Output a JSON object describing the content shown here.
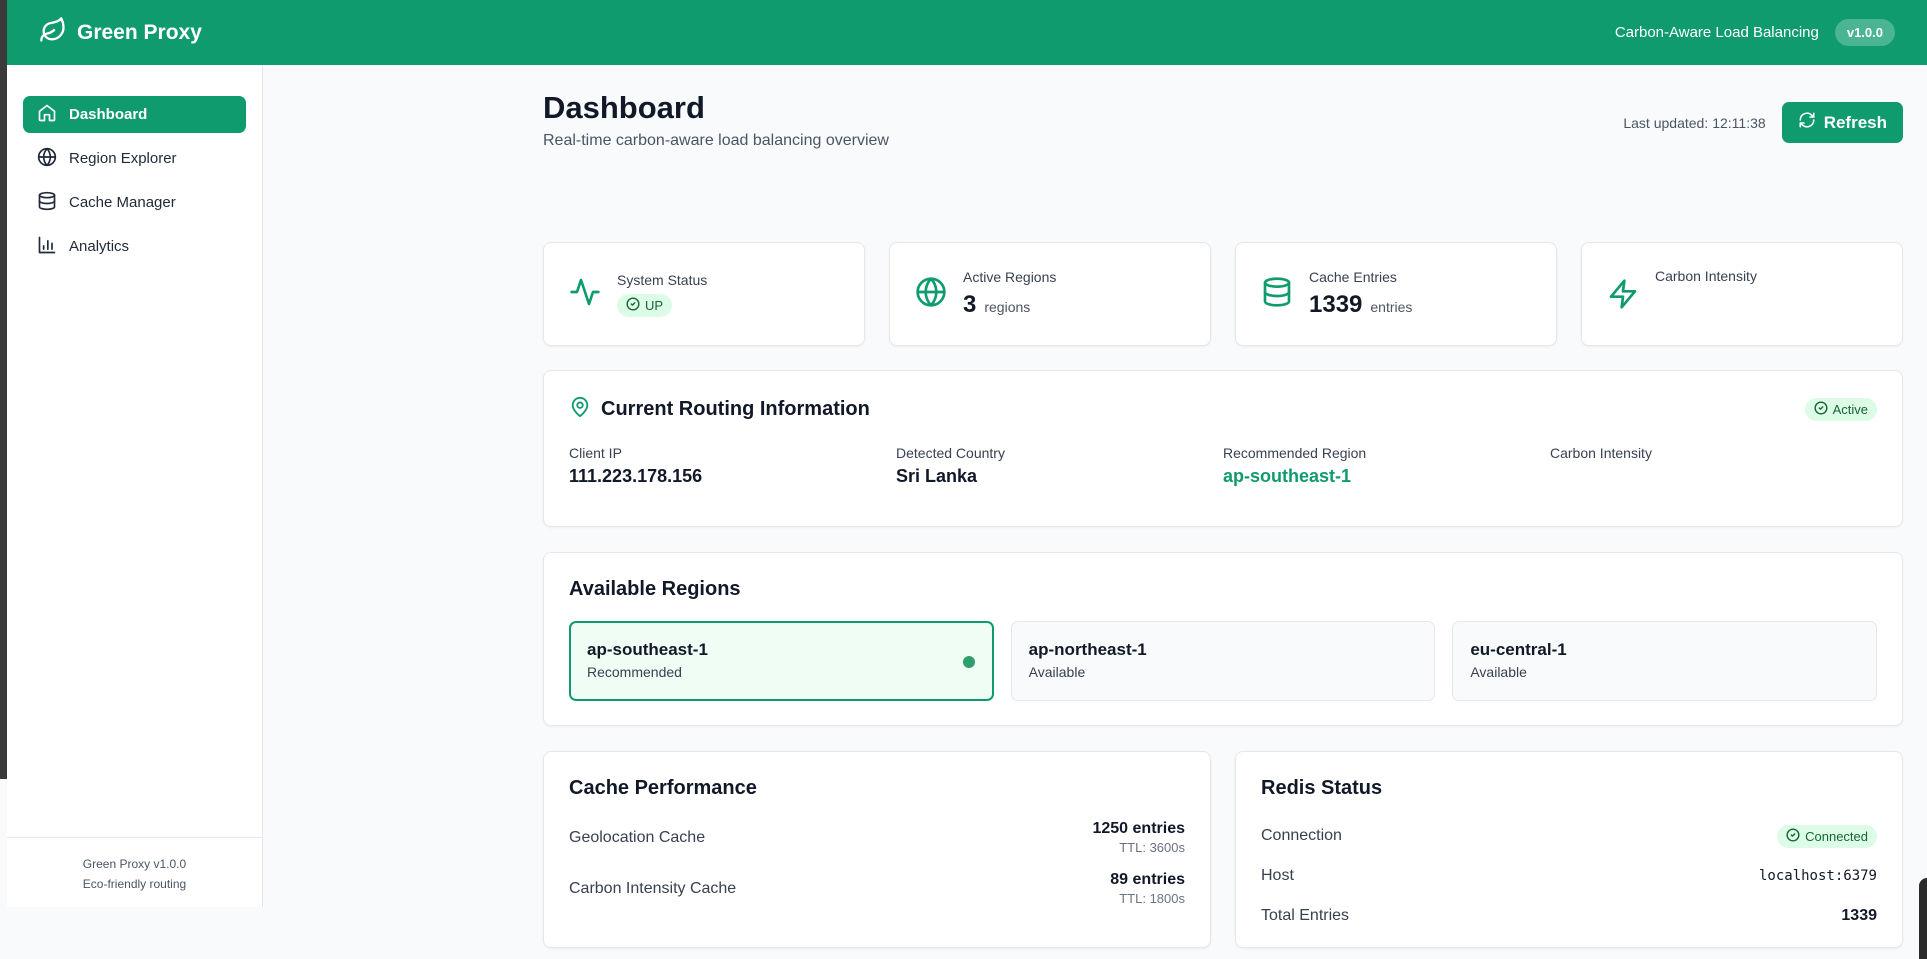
{
  "topbar": {
    "brand": "Green Proxy",
    "tagline": "Carbon-Aware Load Balancing",
    "version": "v1.0.0",
    "accent": "#0f9b6e"
  },
  "sidebar": {
    "items": [
      {
        "label": "Dashboard",
        "icon": "home-icon",
        "active": true
      },
      {
        "label": "Region Explorer",
        "icon": "globe-icon",
        "active": false
      },
      {
        "label": "Cache Manager",
        "icon": "database-icon",
        "active": false
      },
      {
        "label": "Analytics",
        "icon": "bar-chart-icon",
        "active": false
      }
    ],
    "footer_line1": "Green Proxy v1.0.0",
    "footer_line2": "Eco-friendly routing"
  },
  "header": {
    "title": "Dashboard",
    "subtitle": "Real-time carbon-aware load balancing overview",
    "last_updated_label": "Last updated:",
    "last_updated_time": "12:11:38",
    "refresh_label": "Refresh"
  },
  "stats": {
    "system_status": {
      "label": "System Status",
      "value": "UP"
    },
    "active_regions": {
      "label": "Active Regions",
      "value": "3",
      "unit": "regions"
    },
    "cache_entries": {
      "label": "Cache Entries",
      "value": "1339",
      "unit": "entries"
    },
    "carbon_intensity": {
      "label": "Carbon Intensity"
    }
  },
  "routing": {
    "title": "Current Routing Information",
    "status": "Active",
    "client_ip_label": "Client IP",
    "client_ip": "111.223.178.156",
    "country_label": "Detected Country",
    "country": "Sri Lanka",
    "region_label": "Recommended Region",
    "region": "ap-southeast-1",
    "carbon_label": "Carbon Intensity"
  },
  "regions": {
    "title": "Available Regions",
    "items": [
      {
        "name": "ap-southeast-1",
        "status": "Recommended"
      },
      {
        "name": "ap-northeast-1",
        "status": "Available"
      },
      {
        "name": "eu-central-1",
        "status": "Available"
      }
    ]
  },
  "cache_performance": {
    "title": "Cache Performance",
    "rows": [
      {
        "label": "Geolocation Cache",
        "count": "1250 entries",
        "ttl": "TTL: 3600s"
      },
      {
        "label": "Carbon Intensity Cache",
        "count": "89 entries",
        "ttl": "TTL: 1800s"
      }
    ]
  },
  "redis": {
    "title": "Redis Status",
    "connection_label": "Connection",
    "connection": "Connected",
    "host_label": "Host",
    "host": "localhost:6379",
    "total_label": "Total Entries",
    "total": "1339"
  }
}
